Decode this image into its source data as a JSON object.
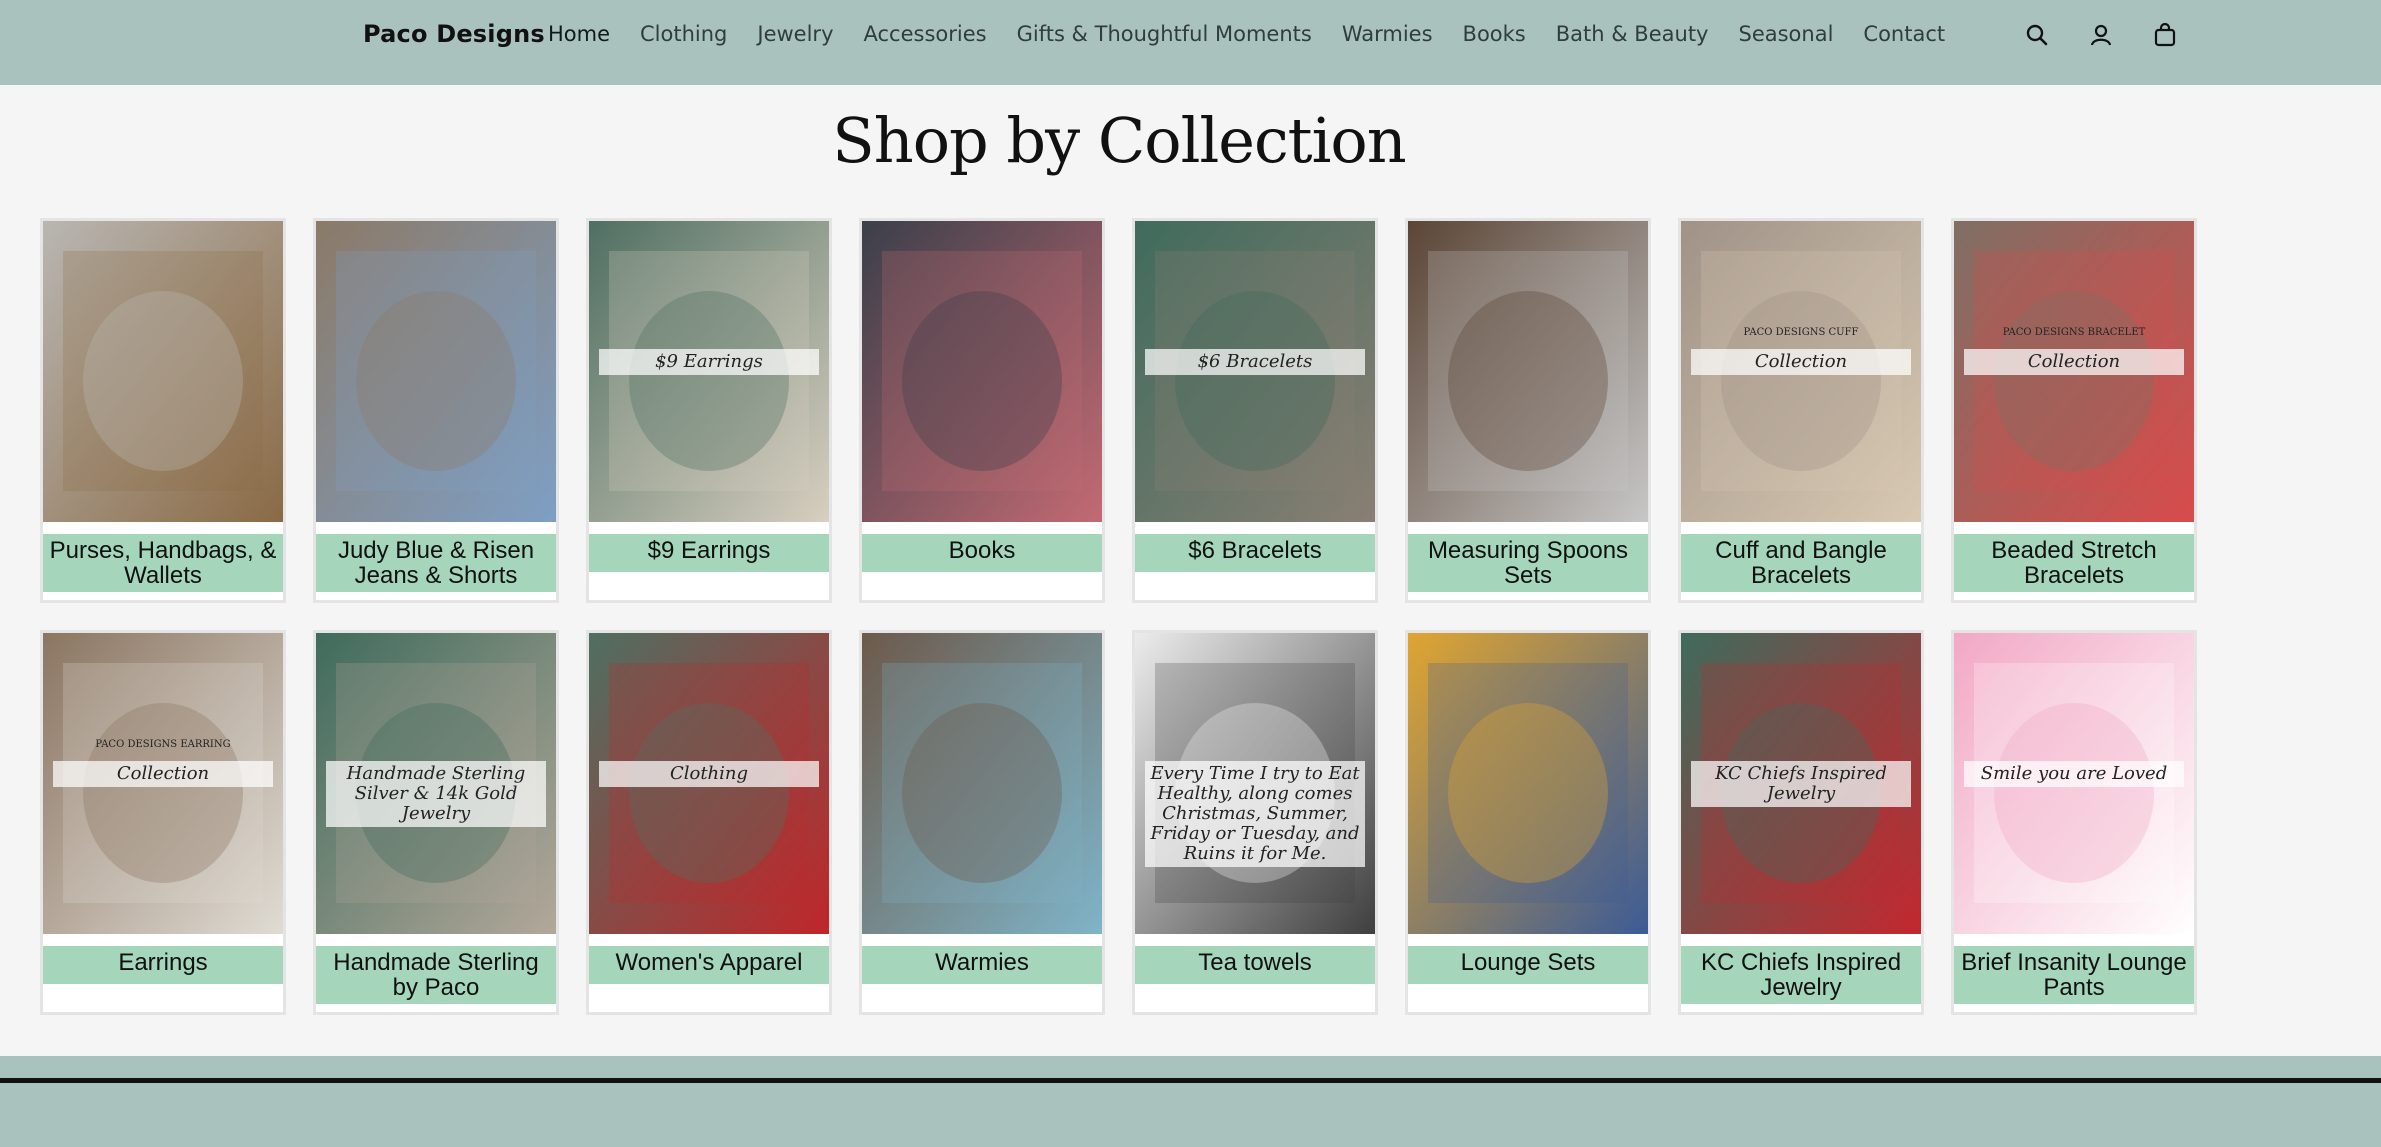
{
  "header": {
    "brand": "Paco Designs",
    "nav": [
      "Home",
      "Clothing",
      "Jewelry",
      "Accessories",
      "Gifts & Thoughtful Moments",
      "Warmies",
      "Books",
      "Bath & Beauty",
      "Seasonal",
      "Contact"
    ],
    "icons": [
      "search-icon",
      "account-icon",
      "cart-icon"
    ]
  },
  "page_title": "Shop by Collection",
  "collections": [
    {
      "label": "Purses, Handbags, & Wallets",
      "colors": [
        "#b9b6b2",
        "#8a6a45"
      ]
    },
    {
      "label": "Judy Blue & Risen Jeans & Shorts",
      "colors": [
        "#8b7a68",
        "#7e9fc4"
      ]
    },
    {
      "label": "$9 Earrings",
      "colors": [
        "#4f6f62",
        "#d8cfc0"
      ],
      "overlay": "$9 Earrings"
    },
    {
      "label": "Books",
      "colors": [
        "#3b3f4a",
        "#c36a73"
      ]
    },
    {
      "label": "$6 Bracelets",
      "colors": [
        "#3f6b5c",
        "#8a7f74"
      ],
      "overlay": "$6 Bracelets"
    },
    {
      "label": "Measuring Spoons Sets",
      "colors": [
        "#5b4536",
        "#c7c7c7"
      ]
    },
    {
      "label": "Cuff and Bangle Bracelets",
      "colors": [
        "#a09287",
        "#d8c9b3"
      ],
      "overlay": "Collection",
      "overlay_kicker": "PACO DESIGNS CUFF"
    },
    {
      "label": "Beaded Stretch Bracelets",
      "colors": [
        "#7f6f64",
        "#d84b4b"
      ],
      "overlay": "Collection",
      "overlay_kicker": "PACO DESIGNS BRACELET"
    },
    {
      "label": "Earrings",
      "colors": [
        "#8b7562",
        "#e0dcd4"
      ],
      "overlay": "Collection",
      "overlay_kicker": "PACO DESIGNS EARRING"
    },
    {
      "label": "Handmade Sterling by Paco",
      "colors": [
        "#3f6b5c",
        "#b3a89a"
      ],
      "overlay": "Handmade Sterling Silver & 14k Gold Jewelry"
    },
    {
      "label": "Women's Apparel",
      "colors": [
        "#4f6f62",
        "#c0262a"
      ],
      "overlay": "Clothing"
    },
    {
      "label": "Warmies",
      "colors": [
        "#6c5a4b",
        "#7fb4c8"
      ]
    },
    {
      "label": "Tea towels",
      "colors": [
        "#ececec",
        "#3f3f3f"
      ],
      "overlay": "Every Time I try to Eat Healthy, along comes Christmas, Summer, Friday or Tuesday, and Ruins it for Me."
    },
    {
      "label": "Lounge Sets",
      "colors": [
        "#e0a531",
        "#3c5b96"
      ]
    },
    {
      "label": "KC Chiefs Inspired Jewelry",
      "colors": [
        "#3f6b5c",
        "#c4272f"
      ],
      "overlay": "KC Chiefs Inspired Jewelry"
    },
    {
      "label": "Brief Insanity Lounge Pants",
      "colors": [
        "#f2a8c4",
        "#ffffff"
      ],
      "overlay": "Smile you are Loved"
    }
  ]
}
